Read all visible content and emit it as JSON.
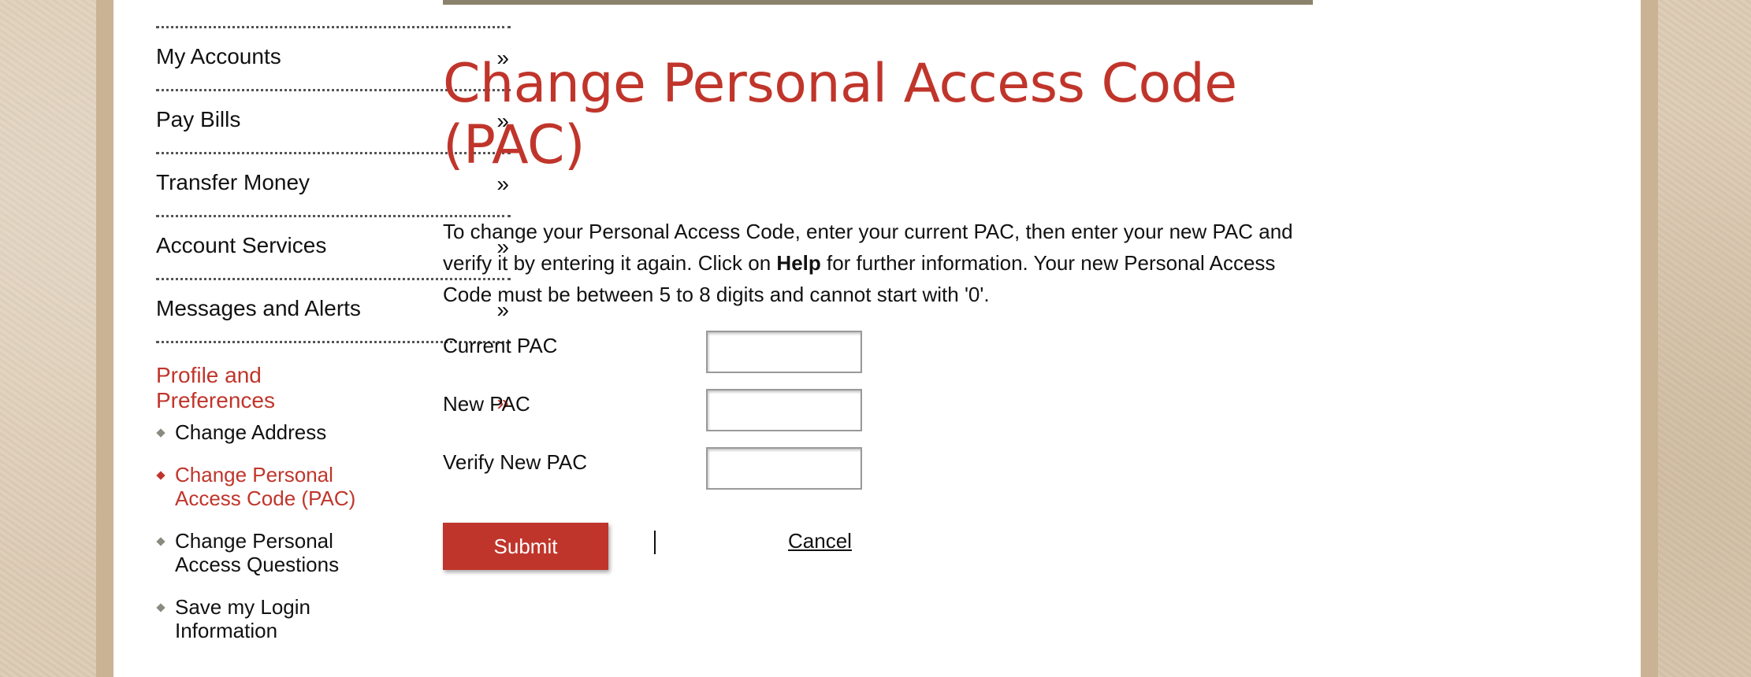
{
  "sidebar": {
    "items": [
      {
        "label": "My Accounts",
        "arrow": "»"
      },
      {
        "label": "Pay Bills",
        "arrow": "»"
      },
      {
        "label": "Transfer Money",
        "arrow": "»"
      },
      {
        "label": "Account Services",
        "arrow": "»"
      },
      {
        "label": "Messages and Alerts",
        "arrow": "»"
      },
      {
        "label": "Profile and Preferences",
        "arrow": "»"
      }
    ],
    "sub_items": [
      {
        "label": "Change Address"
      },
      {
        "label": "Change Personal Access Code (PAC)"
      },
      {
        "label": "Change Personal Access Questions"
      },
      {
        "label": "Save my Login Information"
      }
    ]
  },
  "main": {
    "title": "Change Personal Access Code (PAC)",
    "intro": {
      "before": "To change your Personal Access Code, enter your current PAC, then enter your new PAC and verify it by entering it again. Click on ",
      "help": "Help",
      "after": " for further information. Your new Personal Access Code must be between 5 to 8 digits and cannot start with '0'."
    },
    "fields": [
      {
        "label": "Current PAC",
        "value": ""
      },
      {
        "label": "New PAC",
        "value": ""
      },
      {
        "label": "Verify New PAC",
        "value": ""
      }
    ],
    "submit_label": "Submit",
    "cancel_label": "Cancel"
  },
  "colors": {
    "accent": "#c0352b",
    "top_bar": "#8a826c",
    "background": "#dccbb4"
  }
}
